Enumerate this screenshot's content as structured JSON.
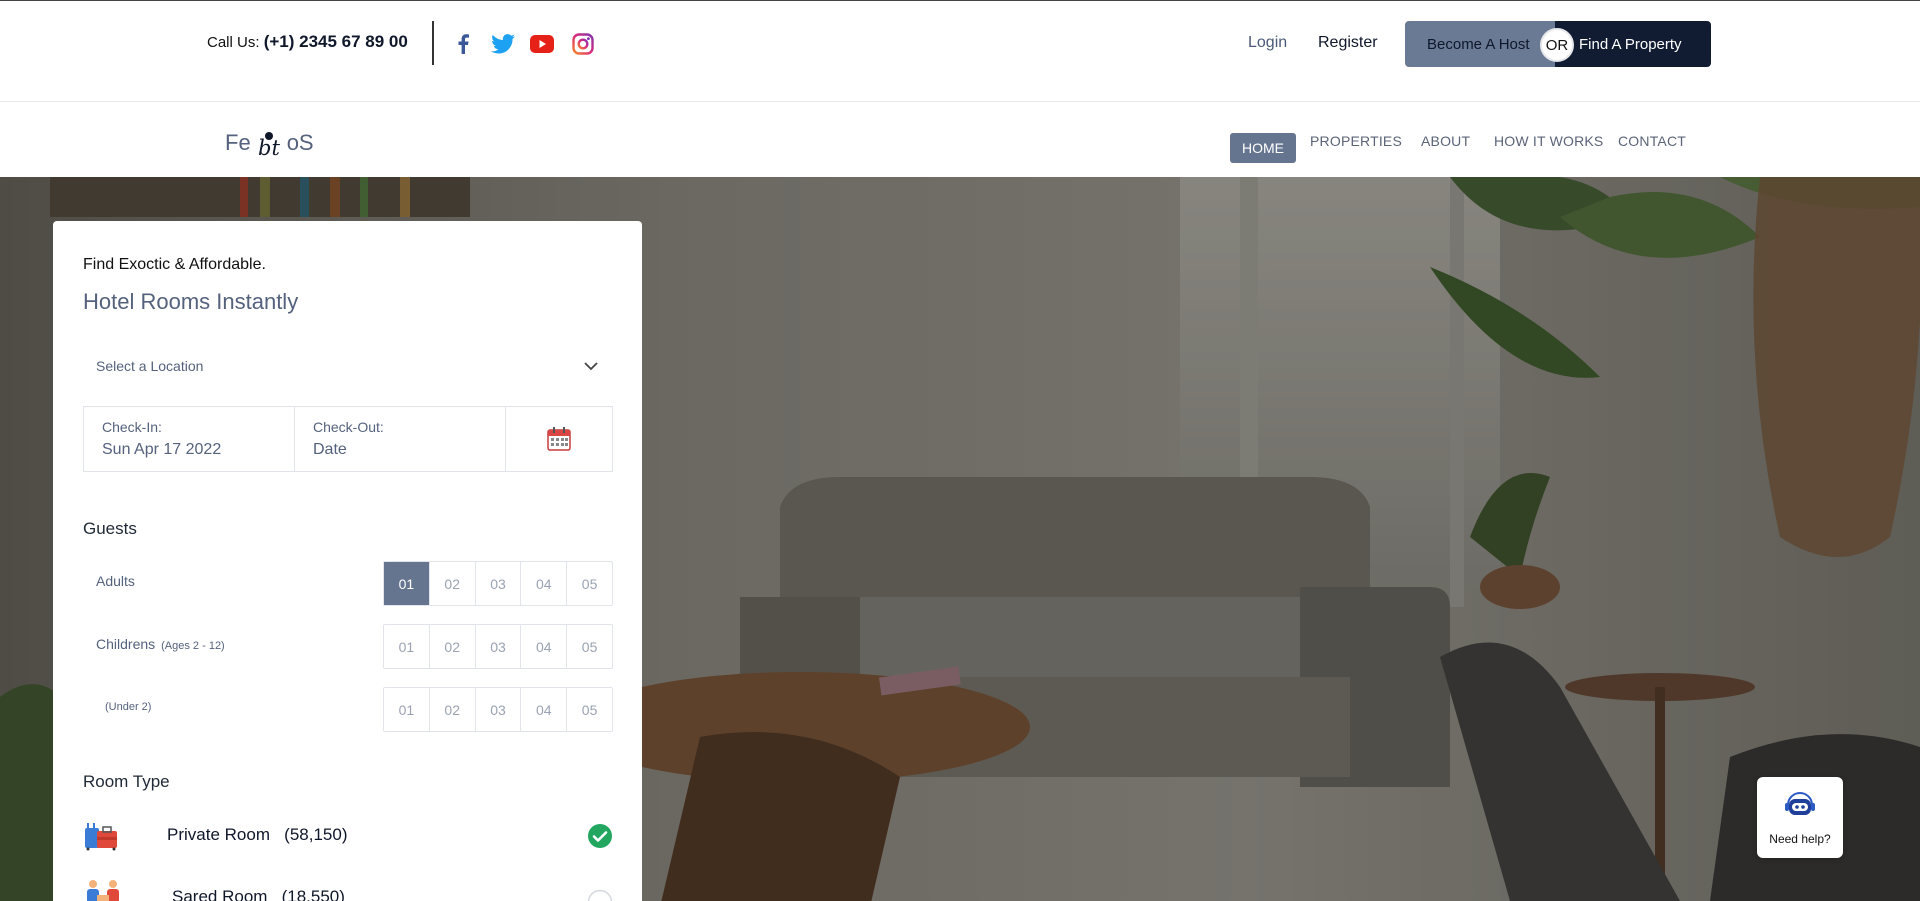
{
  "topbar": {
    "call_label": "Call Us:",
    "phone": "(+1) 2345 67 89 00",
    "login": "Login",
    "register": "Register",
    "become_host": "Become A Host",
    "or": "OR",
    "find_property": "Find A Property"
  },
  "social": [
    {
      "icon": "facebook-icon",
      "color": "#3b5998"
    },
    {
      "icon": "twitter-icon",
      "color": "#1da1f2"
    },
    {
      "icon": "youtube-icon",
      "color": "#e62117"
    },
    {
      "icon": "instagram-icon",
      "color": "#c13584"
    }
  ],
  "brand": {
    "left": "Fe",
    "mid": "bt",
    "right": "oS"
  },
  "nav": {
    "items": [
      "HOME",
      "PROPERTIES",
      "ABOUT",
      "HOW IT WORKS",
      "CONTACT"
    ],
    "active": "HOME"
  },
  "search": {
    "subtitle": "Find Exoctic & Affordable.",
    "title": "Hotel Rooms Instantly",
    "location_placeholder": "Select a Location",
    "checkin_label": "Check-In:",
    "checkin_value": "Sun Apr 17 2022",
    "checkout_label": "Check-Out:",
    "checkout_value": "Date",
    "guests_heading": "Guests",
    "adults_label": "Adults",
    "children_label": "Childrens",
    "children_note": "(Ages 2 - 12)",
    "infants_note": "(Under 2)",
    "options": [
      "01",
      "02",
      "03",
      "04",
      "05"
    ],
    "adults_selected": "01",
    "room_type_heading": "Room Type",
    "rooms": [
      {
        "name": "Private Room",
        "count": "(58,150)",
        "selected": true
      },
      {
        "name": "Sared Room",
        "count": "(18,550)",
        "selected": false
      }
    ]
  },
  "help": {
    "label": "Need help?"
  },
  "colors": {
    "accent": "#66758f",
    "dark": "#111c33",
    "check": "#22a660"
  }
}
